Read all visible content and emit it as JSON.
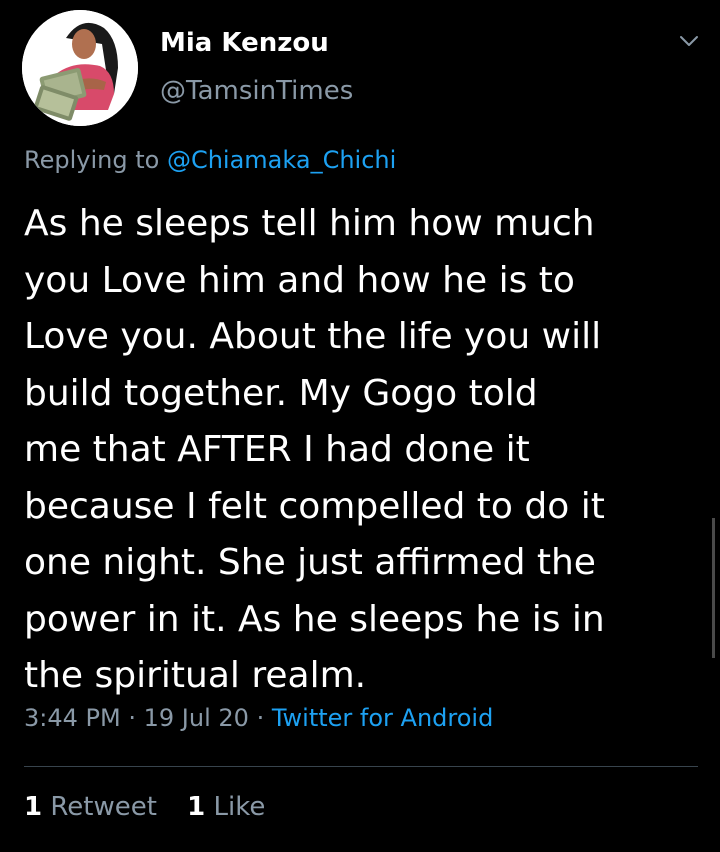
{
  "author": {
    "name": "Mia Kenzou",
    "handle": "@TamsinTimes"
  },
  "reply": {
    "prefix": "Replying to",
    "mention": "@Chiamaka_Chichi"
  },
  "body_lines": [
    "As he sleeps tell him how much",
    "you Love him and how he is to",
    "Love you. About the life you will",
    "build together. My Gogo told",
    "me that AFTER I had done it",
    "because I felt compelled to do it",
    "one night. She just affirmed the",
    "power in it. As he sleeps he is in",
    "the spiritual realm."
  ],
  "meta": {
    "time": "3:44 PM",
    "sep1": "·",
    "date": "19 Jul 20",
    "sep2": "·",
    "source": "Twitter for Android"
  },
  "stats": {
    "retweets_count": "1",
    "retweets_label": "Retweet",
    "likes_count": "1",
    "likes_label": "Like"
  },
  "colors": {
    "background": "#000000",
    "text": "#ffffff",
    "muted": "#8a99a7",
    "link": "#1da1f2",
    "divider": "#38444d"
  },
  "icons": {
    "caret": "chevron-down-icon",
    "avatar": "avatar"
  }
}
